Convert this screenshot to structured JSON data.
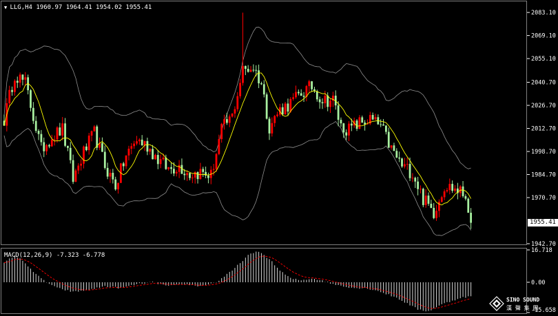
{
  "header": {
    "symbol_line": "LLG,H4  1960.97 1964.41 1954.02 1955.41"
  },
  "macd": {
    "label": "MACD(12,26,9) -7.323 -6.778",
    "axis_labels": [
      "16.718",
      "0.00",
      "-15.658"
    ]
  },
  "current_price_label": "1955.41",
  "logo": {
    "brand": "SINO SOUND",
    "cn": "漢 聲 集 團"
  },
  "colors": {
    "bull": "#ff0000",
    "bear": "#a8f0a0",
    "ma": "#ffff00",
    "band": "#909090",
    "signal": "#ff0000",
    "hist": "#d8d8d8"
  },
  "chart_data": {
    "type": "candlestick",
    "symbol": "LLG",
    "timeframe": "H4",
    "ylim": [
      1942.7,
      2089
    ],
    "y_ticks": [
      2083.1,
      2069.1,
      2055.1,
      2040.7,
      2026.7,
      2012.7,
      1998.7,
      1984.7,
      1970.7,
      1955.41,
      1942.7
    ],
    "y_tick_labels": [
      "2083.10",
      "2069.10",
      "2055.10",
      "2040.70",
      "2026.70",
      "2012.70",
      "1998.70",
      "1984.70",
      "1970.70",
      "1942.70"
    ],
    "price_anchors": [
      [
        0,
        2018
      ],
      [
        4,
        2046
      ],
      [
        8,
        2040
      ],
      [
        11,
        2020
      ],
      [
        14,
        2000
      ],
      [
        18,
        2008
      ],
      [
        22,
        2012
      ],
      [
        26,
        1982
      ],
      [
        30,
        1998
      ],
      [
        34,
        2010
      ],
      [
        38,
        1990
      ],
      [
        42,
        1978
      ],
      [
        46,
        1996
      ],
      [
        50,
        2006
      ],
      [
        54,
        2002
      ],
      [
        58,
        1994
      ],
      [
        62,
        1988
      ],
      [
        66,
        1990
      ],
      [
        70,
        1985
      ],
      [
        74,
        1986
      ],
      [
        78,
        1984
      ],
      [
        82,
        2012
      ],
      [
        86,
        2020
      ],
      [
        90,
        2048
      ],
      [
        94,
        2050
      ],
      [
        97,
        2040
      ],
      [
        100,
        2014
      ],
      [
        104,
        2024
      ],
      [
        108,
        2028
      ],
      [
        112,
        2034
      ],
      [
        116,
        2038
      ],
      [
        120,
        2030
      ],
      [
        124,
        2030
      ],
      [
        127,
        2014
      ],
      [
        130,
        2012
      ],
      [
        134,
        2016
      ],
      [
        138,
        2018
      ],
      [
        142,
        2014
      ],
      [
        146,
        2000
      ],
      [
        150,
        1990
      ],
      [
        154,
        1986
      ],
      [
        158,
        1970
      ],
      [
        162,
        1962
      ],
      [
        166,
        1978
      ],
      [
        170,
        1976
      ],
      [
        174,
        1972
      ],
      [
        176,
        1958
      ]
    ],
    "macd_range": [
      -15.658,
      16.718
    ],
    "macd_anchors": [
      [
        0,
        10
      ],
      [
        4,
        14
      ],
      [
        8,
        10
      ],
      [
        12,
        4
      ],
      [
        16,
        0
      ],
      [
        20,
        -3
      ],
      [
        26,
        -5
      ],
      [
        32,
        -4
      ],
      [
        38,
        -2
      ],
      [
        44,
        -3
      ],
      [
        50,
        -1
      ],
      [
        56,
        0
      ],
      [
        62,
        -2
      ],
      [
        68,
        -1
      ],
      [
        74,
        -2
      ],
      [
        80,
        0
      ],
      [
        86,
        6
      ],
      [
        92,
        14
      ],
      [
        96,
        16
      ],
      [
        100,
        12
      ],
      [
        104,
        6
      ],
      [
        108,
        2
      ],
      [
        112,
        1
      ],
      [
        116,
        2
      ],
      [
        120,
        1
      ],
      [
        124,
        -1
      ],
      [
        128,
        -2
      ],
      [
        132,
        -3
      ],
      [
        136,
        -3
      ],
      [
        140,
        -4
      ],
      [
        144,
        -6
      ],
      [
        148,
        -8
      ],
      [
        152,
        -11
      ],
      [
        156,
        -14
      ],
      [
        160,
        -15
      ],
      [
        164,
        -12
      ],
      [
        168,
        -10
      ],
      [
        172,
        -8
      ],
      [
        176,
        -7.3
      ]
    ]
  }
}
